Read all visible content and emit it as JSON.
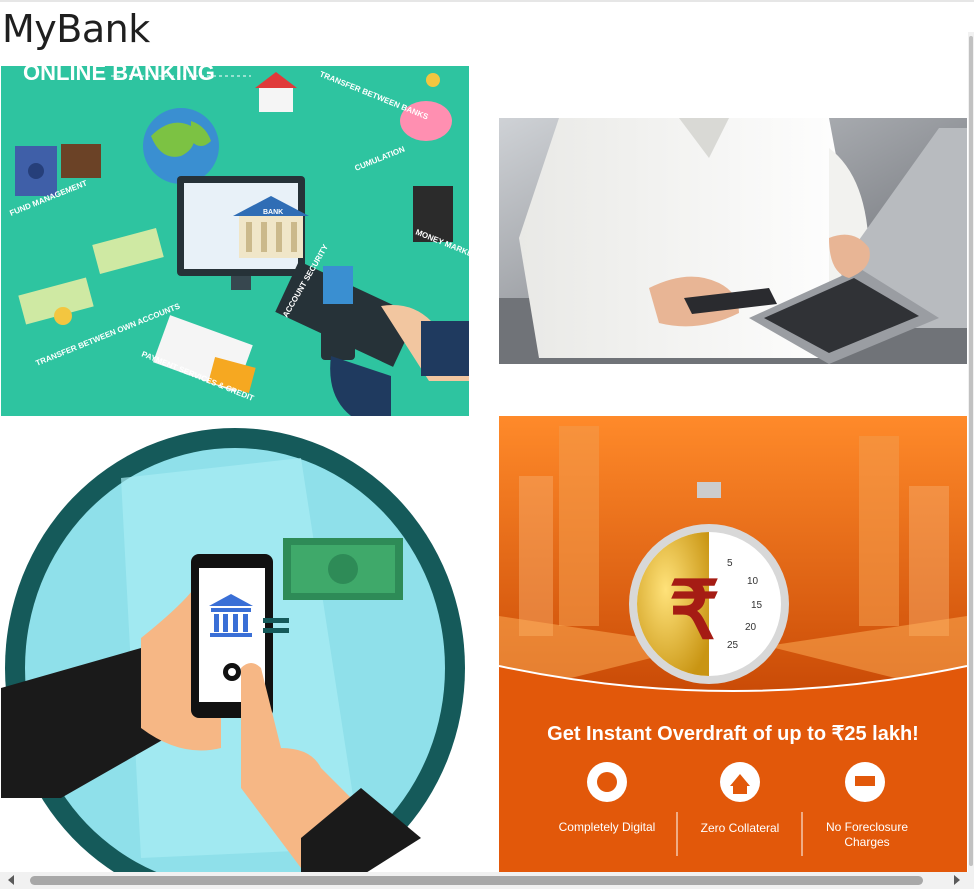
{
  "app": {
    "title": "MyBank"
  },
  "tiles": {
    "online_banking": {
      "heading": "ONLINE BANKING",
      "labels": {
        "transfer_banks": "TRANSFER BETWEEN BANKS",
        "fund_management": "FUND MANAGEMENT",
        "cumulation": "CUMULATION",
        "money_market": "MONEY MARKET",
        "account_security": "ACCOUNT SECURITY",
        "transfer_own": "TRANSFER BETWEEN OWN ACCOUNTS",
        "payment": "PAYMENT SERVICES & CREDIT",
        "bank": "BANK"
      }
    },
    "overdraft": {
      "headline": "Get Instant Overdraft of up to ₹25 lakh!",
      "features": [
        "Completely Digital",
        "Zero Collateral",
        "No Foreclosure Charges"
      ],
      "dial_numbers": [
        "5",
        "10",
        "15",
        "20",
        "25"
      ],
      "currency_symbol": "₹"
    }
  },
  "colors": {
    "online_banking_bg": "#2ec4a0",
    "overdraft_bg": "#e2580a",
    "mobile_circle": "#155a5a"
  }
}
